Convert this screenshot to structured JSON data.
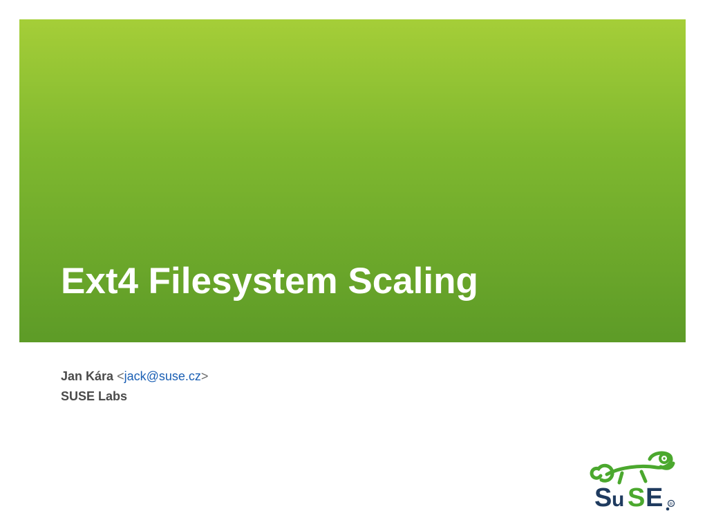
{
  "title": "Ext4 Filesystem Scaling",
  "author": {
    "name": "Jan Kára",
    "email": "jack@suse.cz",
    "org": "SUSE Labs"
  },
  "logo": {
    "brand": "SuSE",
    "accent_color": "#4ba82e",
    "text_color": "#1f3b5f"
  }
}
